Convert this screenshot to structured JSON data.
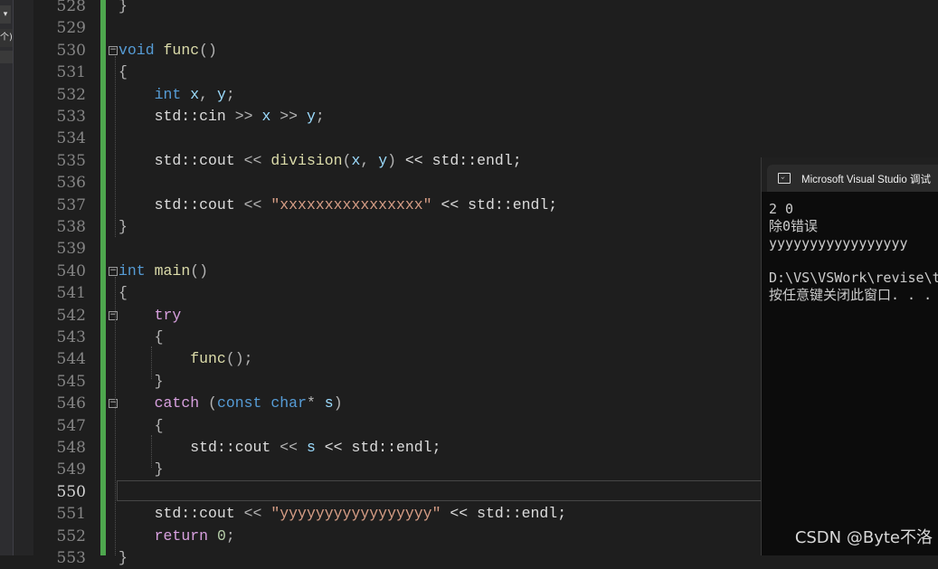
{
  "left_panel": {
    "dropdown_glyph": "▾",
    "label": "个)"
  },
  "editor": {
    "current_line": 550,
    "lines": [
      {
        "n": 528,
        "fold": false,
        "segs": [
          {
            "t": "}",
            "c": "op"
          }
        ]
      },
      {
        "n": 529,
        "fold": false,
        "segs": []
      },
      {
        "n": 530,
        "fold": true,
        "segs": [
          {
            "t": "void",
            "c": "kw"
          },
          {
            "t": " ",
            "c": ""
          },
          {
            "t": "func",
            "c": "fn"
          },
          {
            "t": "()",
            "c": "op"
          }
        ]
      },
      {
        "n": 531,
        "fold": false,
        "segs": [
          {
            "t": "{",
            "c": "op"
          }
        ]
      },
      {
        "n": 532,
        "fold": false,
        "segs": [
          {
            "t": "    ",
            "c": ""
          },
          {
            "t": "int",
            "c": "kw"
          },
          {
            "t": " ",
            "c": ""
          },
          {
            "t": "x",
            "c": "var"
          },
          {
            "t": ", ",
            "c": "op"
          },
          {
            "t": "y",
            "c": "var"
          },
          {
            "t": ";",
            "c": "op"
          }
        ]
      },
      {
        "n": 533,
        "fold": false,
        "segs": [
          {
            "t": "    std::cin ",
            "c": ""
          },
          {
            "t": ">>",
            "c": "op"
          },
          {
            "t": " ",
            "c": ""
          },
          {
            "t": "x",
            "c": "var"
          },
          {
            "t": " >> ",
            "c": "op"
          },
          {
            "t": "y",
            "c": "var"
          },
          {
            "t": ";",
            "c": "op"
          }
        ]
      },
      {
        "n": 534,
        "fold": false,
        "segs": []
      },
      {
        "n": 535,
        "fold": false,
        "segs": [
          {
            "t": "    std::cout ",
            "c": ""
          },
          {
            "t": "<<",
            "c": "op"
          },
          {
            "t": " ",
            "c": ""
          },
          {
            "t": "division",
            "c": "fn"
          },
          {
            "t": "(",
            "c": "op"
          },
          {
            "t": "x",
            "c": "var"
          },
          {
            "t": ", ",
            "c": "op"
          },
          {
            "t": "y",
            "c": "var"
          },
          {
            "t": ")",
            "c": "op"
          },
          {
            "t": " << std::endl;",
            "c": ""
          }
        ]
      },
      {
        "n": 536,
        "fold": false,
        "segs": []
      },
      {
        "n": 537,
        "fold": false,
        "segs": [
          {
            "t": "    std::cout ",
            "c": ""
          },
          {
            "t": "<<",
            "c": "op"
          },
          {
            "t": " ",
            "c": ""
          },
          {
            "t": "\"xxxxxxxxxxxxxxxx\"",
            "c": "str"
          },
          {
            "t": " << std::endl;",
            "c": ""
          }
        ]
      },
      {
        "n": 538,
        "fold": false,
        "segs": [
          {
            "t": "}",
            "c": "op"
          }
        ]
      },
      {
        "n": 539,
        "fold": false,
        "segs": []
      },
      {
        "n": 540,
        "fold": true,
        "segs": [
          {
            "t": "int",
            "c": "kw"
          },
          {
            "t": " ",
            "c": ""
          },
          {
            "t": "main",
            "c": "fn"
          },
          {
            "t": "()",
            "c": "op"
          }
        ]
      },
      {
        "n": 541,
        "fold": false,
        "segs": [
          {
            "t": "{",
            "c": "op"
          }
        ]
      },
      {
        "n": 542,
        "fold": true,
        "segs": [
          {
            "t": "    ",
            "c": ""
          },
          {
            "t": "try",
            "c": "kw2"
          }
        ]
      },
      {
        "n": 543,
        "fold": false,
        "segs": [
          {
            "t": "    {",
            "c": "op"
          }
        ]
      },
      {
        "n": 544,
        "fold": false,
        "segs": [
          {
            "t": "        ",
            "c": ""
          },
          {
            "t": "func",
            "c": "fn"
          },
          {
            "t": "();",
            "c": "op"
          }
        ]
      },
      {
        "n": 545,
        "fold": false,
        "segs": [
          {
            "t": "    }",
            "c": "op"
          }
        ]
      },
      {
        "n": 546,
        "fold": true,
        "segs": [
          {
            "t": "    ",
            "c": ""
          },
          {
            "t": "catch",
            "c": "kw2"
          },
          {
            "t": " (",
            "c": "op"
          },
          {
            "t": "const",
            "c": "kw"
          },
          {
            "t": " ",
            "c": ""
          },
          {
            "t": "char",
            "c": "kw"
          },
          {
            "t": "* ",
            "c": "op"
          },
          {
            "t": "s",
            "c": "var"
          },
          {
            "t": ")",
            "c": "op"
          }
        ]
      },
      {
        "n": 547,
        "fold": false,
        "segs": [
          {
            "t": "    {",
            "c": "op"
          }
        ]
      },
      {
        "n": 548,
        "fold": false,
        "segs": [
          {
            "t": "        std::cout ",
            "c": ""
          },
          {
            "t": "<<",
            "c": "op"
          },
          {
            "t": " ",
            "c": ""
          },
          {
            "t": "s",
            "c": "var"
          },
          {
            "t": " << std::endl;",
            "c": ""
          }
        ]
      },
      {
        "n": 549,
        "fold": false,
        "segs": [
          {
            "t": "    }",
            "c": "op"
          }
        ]
      },
      {
        "n": 550,
        "fold": false,
        "segs": []
      },
      {
        "n": 551,
        "fold": false,
        "segs": [
          {
            "t": "    std::cout ",
            "c": ""
          },
          {
            "t": "<<",
            "c": "op"
          },
          {
            "t": " ",
            "c": ""
          },
          {
            "t": "\"yyyyyyyyyyyyyyyyy\"",
            "c": "str"
          },
          {
            "t": " << std::endl;",
            "c": ""
          }
        ]
      },
      {
        "n": 552,
        "fold": false,
        "segs": [
          {
            "t": "    ",
            "c": ""
          },
          {
            "t": "return",
            "c": "kw2"
          },
          {
            "t": " ",
            "c": ""
          },
          {
            "t": "0",
            "c": "num"
          },
          {
            "t": ";",
            "c": "op"
          }
        ]
      },
      {
        "n": 553,
        "fold": false,
        "segs": [
          {
            "t": "}",
            "c": "op"
          }
        ]
      }
    ]
  },
  "console": {
    "title": "Microsoft Visual Studio 调试",
    "output_lines": [
      "2 0",
      "除0错误",
      "yyyyyyyyyyyyyyyyy",
      "",
      "D:\\VS\\VSWork\\revise\\t",
      "按任意键关闭此窗口. . ."
    ]
  },
  "watermark": "CSDN @Byte不洛"
}
